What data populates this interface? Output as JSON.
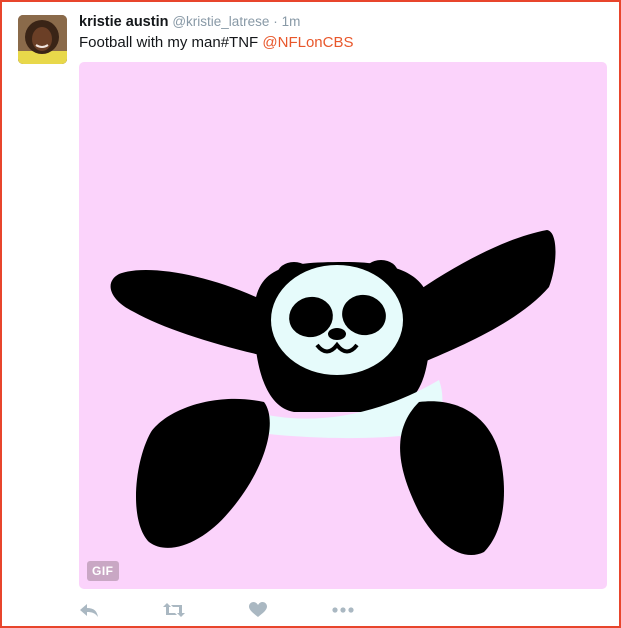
{
  "tweet": {
    "display_name": "kristie austin",
    "handle": "@kristie_latrese",
    "separator": "·",
    "time": "1m",
    "text": "Football with my man#TNF",
    "mention": "@NFLonCBS"
  },
  "media": {
    "badge": "GIF",
    "background_color": "#fbd3fb"
  },
  "actions": [
    {
      "name": "reply",
      "icon": "reply-icon"
    },
    {
      "name": "retweet",
      "icon": "retweet-icon"
    },
    {
      "name": "like",
      "icon": "heart-icon"
    },
    {
      "name": "more",
      "icon": "more-icon"
    }
  ],
  "colors": {
    "mention": "#e8572b",
    "frame": "#e8452c",
    "icon": "#aab8c2"
  }
}
